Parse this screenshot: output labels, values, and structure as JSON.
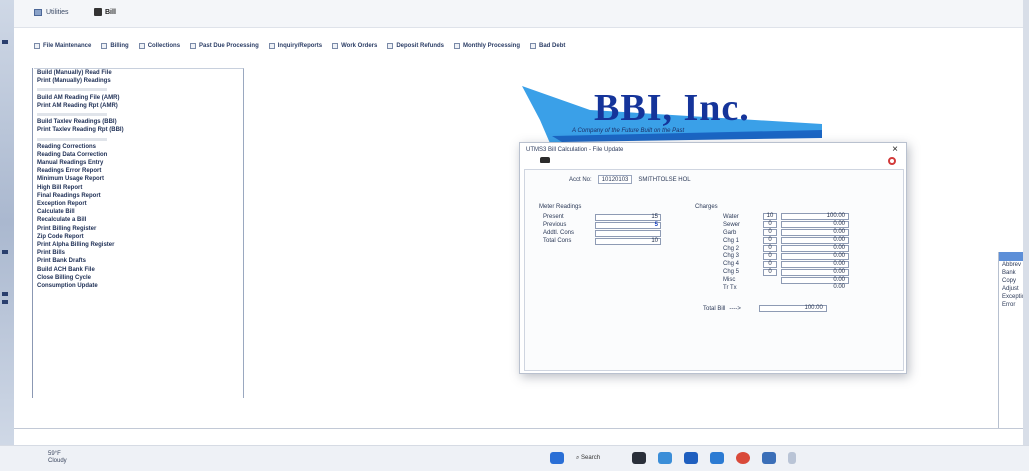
{
  "window": {
    "title": "Utilities",
    "toolbar_label": "Bill"
  },
  "menu": [
    "File Maintenance",
    "Billing",
    "Collections",
    "Past Due Processing",
    "Inquiry/Reports",
    "Work Orders",
    "Deposit Refunds",
    "Monthly Processing",
    "Bad Debt"
  ],
  "sidebar": {
    "items": [
      "Build (Manually) Read File",
      "Print (Manually) Readings",
      "",
      "Build AM Reading File (AMR)",
      "Print AM Reading Rpt (AMR)",
      "",
      "Build Taxlev Readings (BBI)",
      "Print Taxlev Reading Rpt (BBI)",
      "",
      "Reading Corrections",
      "Reading Data Correction",
      "Manual Readings Entry",
      "Readings Error Report",
      "Minimum Usage Report",
      "High Bill Report",
      "Final Readings Report",
      "Exception Report",
      "Calculate Bill",
      "Recalculate a Bill",
      "Print Billing Register",
      "Zip Code Report",
      "Print Alpha Billing Register",
      "Print Bills",
      "Print Bank Drafts",
      "Build ACH Bank File",
      "Close Billing Cycle",
      "Consumption Update"
    ]
  },
  "logo": {
    "brand": "BBI, Inc.",
    "tagline": "A Company of the Future Built on the Past"
  },
  "dialog": {
    "title": "UTMS3 Bill Calculation - File Update",
    "close": "×",
    "account_label": "Acct No:",
    "account_number": "10120103",
    "account_name": "SMITHTOLSE HOL",
    "meter_heading": "Meter Readings",
    "meter_rows": [
      {
        "label": "Present",
        "value": "15",
        "highlight": false
      },
      {
        "label": "Previous",
        "value": "5",
        "highlight": true
      },
      {
        "label": "Addtl. Cons",
        "value": "",
        "highlight": false
      },
      {
        "label": "Total Cons",
        "value": "10",
        "highlight": false
      }
    ],
    "charges_heading": "Charges",
    "charge_rows": [
      {
        "label": "Water",
        "count": "10",
        "amount": "100.00",
        "plain": false,
        "no_count": false
      },
      {
        "label": "Sewer",
        "count": "0",
        "amount": "0.00",
        "plain": false,
        "no_count": false
      },
      {
        "label": "Garb",
        "count": "0",
        "amount": "0.00",
        "plain": false,
        "no_count": false
      },
      {
        "label": "Chg 1",
        "count": "0",
        "amount": "0.00",
        "plain": false,
        "no_count": false
      },
      {
        "label": "Chg 2",
        "count": "0",
        "amount": "0.00",
        "plain": false,
        "no_count": false
      },
      {
        "label": "Chg 3",
        "count": "0",
        "amount": "0.00",
        "plain": false,
        "no_count": false
      },
      {
        "label": "Chg 4",
        "count": "0",
        "amount": "0.00",
        "plain": false,
        "no_count": false
      },
      {
        "label": "Chg 5",
        "count": "0",
        "amount": "0.00",
        "plain": false,
        "no_count": false
      },
      {
        "label": "Misc",
        "count": "",
        "amount": "0.00",
        "plain": false,
        "no_count": true
      },
      {
        "label": "Tr Tx",
        "count": "",
        "amount": "0.00",
        "plain": true,
        "no_count": true
      }
    ],
    "total_label": "Total Bill",
    "total_arrow": "---->",
    "total_amount": "100.00"
  },
  "right_panel": {
    "items": [
      "Abbrev",
      "Bank",
      "Copy",
      "Adjust",
      "Exceptions",
      "Error"
    ]
  },
  "taskbar": {
    "weather_temp": "59°F",
    "weather_text": "Cloudy",
    "search": "Search"
  },
  "colors": {
    "brand_blue": "#15349a",
    "swoosh": "#3aa0e8",
    "accent_blue": "#1740c0",
    "close_red": "#d23a3a"
  }
}
